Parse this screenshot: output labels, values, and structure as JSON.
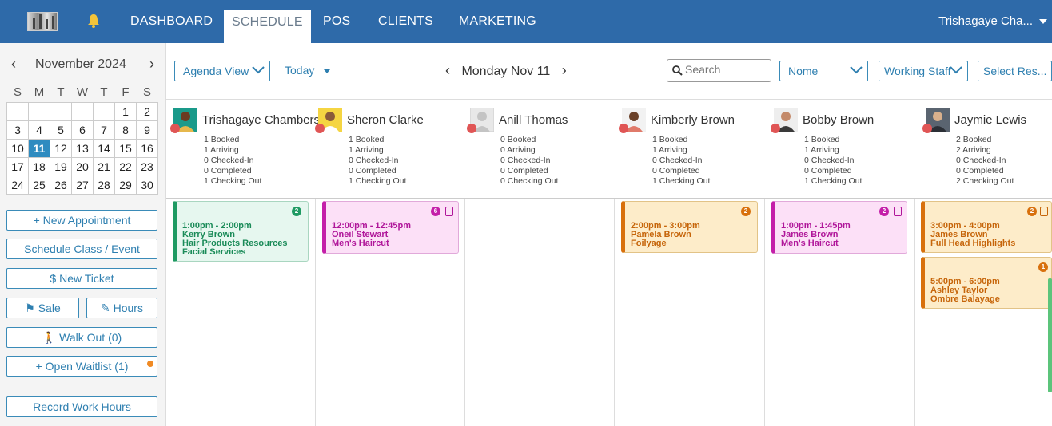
{
  "nav": {
    "items": [
      "DASHBOARD",
      "SCHEDULE",
      "POS",
      "CLIENTS",
      "MARKETING"
    ],
    "active": "SCHEDULE",
    "user": "Trishagaye Cha..."
  },
  "calendar": {
    "month": "November 2024",
    "weekdays": [
      "S",
      "M",
      "T",
      "W",
      "T",
      "F",
      "S"
    ],
    "weeks": [
      [
        "",
        "",
        "",
        "",
        "",
        "1",
        "2"
      ],
      [
        "3",
        "4",
        "5",
        "6",
        "7",
        "8",
        "9"
      ],
      [
        "10",
        "11",
        "12",
        "13",
        "14",
        "15",
        "16"
      ],
      [
        "17",
        "18",
        "19",
        "20",
        "21",
        "22",
        "23"
      ],
      [
        "24",
        "25",
        "26",
        "27",
        "28",
        "29",
        "30"
      ]
    ],
    "selected": "11"
  },
  "sidebar_buttons": {
    "new_appointment": "+ New Appointment",
    "schedule_class": "Schedule Class / Event",
    "new_ticket": "$  New Ticket",
    "sale": "Sale",
    "hours": "Hours",
    "walk_out": "Walk Out (0)",
    "open_waitlist": "+ Open Waitlist (1)",
    "record_work_hours": "Record Work Hours"
  },
  "toolbar": {
    "view": "Agenda View",
    "today": "Today",
    "date": "Monday Nov 11",
    "search_placeholder": "Search",
    "filter1": "Nome",
    "filter2": "Working Staff",
    "filter3": "Select Res..."
  },
  "staff": [
    {
      "name": "Trishagaye Chambers",
      "stats": [
        "1 Booked",
        "1 Arriving",
        "0 Checked-In",
        "0 Completed",
        "1 Checking Out"
      ]
    },
    {
      "name": "Sheron Clarke",
      "stats": [
        "1 Booked",
        "1 Arriving",
        "0 Checked-In",
        "0 Completed",
        "1 Checking Out"
      ]
    },
    {
      "name": "Anill Thomas",
      "stats": [
        "0 Booked",
        "0 Arriving",
        "0 Checked-In",
        "0 Completed",
        "0 Checking Out"
      ]
    },
    {
      "name": "Kimberly Brown",
      "stats": [
        "1 Booked",
        "1 Arriving",
        "0 Checked-In",
        "0 Completed",
        "1 Checking Out"
      ]
    },
    {
      "name": "Bobby Brown",
      "stats": [
        "1 Booked",
        "1 Arriving",
        "0 Checked-In",
        "0 Completed",
        "1 Checking Out"
      ]
    },
    {
      "name": "Jaymie Lewis",
      "stats": [
        "2 Booked",
        "2 Arriving",
        "0 Checked-In",
        "0 Completed",
        "2 Checking Out"
      ]
    }
  ],
  "appointments": [
    {
      "time": "1:00pm - 2:00pm",
      "client": "Kerry Brown",
      "service": "Hair Products Resources",
      "extra": "Facial Services",
      "badge": "2"
    },
    {
      "time": "12:00pm - 12:45pm",
      "client": "Oneil Stewart",
      "service": "Men's Haircut",
      "badge": "6"
    },
    {
      "time": "2:00pm - 3:00pm",
      "client": "Pamela Brown",
      "service": "Foilyage",
      "badge": "2"
    },
    {
      "time": "1:00pm - 1:45pm",
      "client": "James Brown",
      "service": "Men's Haircut",
      "badge": "2"
    },
    {
      "time": "3:00pm - 4:00pm",
      "client": "James Brown",
      "service": "Full Head Highlights",
      "badge": "2"
    },
    {
      "time": "5:00pm - 6:00pm",
      "client": "Ashley Taylor",
      "service": "Ombre Balayage",
      "badge": "1"
    }
  ],
  "colors": {
    "nav_bg": "#2e6aa9",
    "accent": "#2e7fb0",
    "green": "#1e9a62",
    "pink": "#c41fa9",
    "orange": "#d8700c",
    "status_dot": "#e05555"
  }
}
